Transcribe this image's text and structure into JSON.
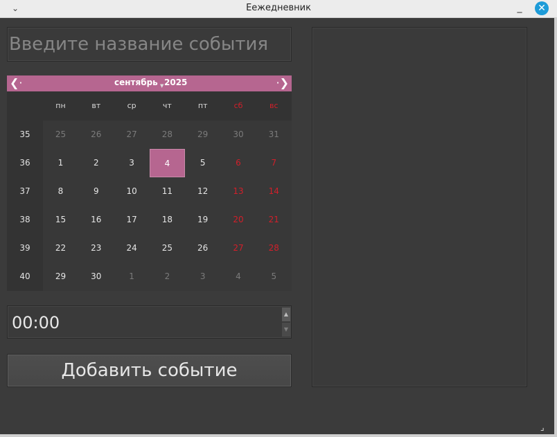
{
  "window": {
    "title": "Еежедневник",
    "menu_icon": "chevron-down-icon",
    "minimize_label": "_",
    "close_label": "✕"
  },
  "event_title_input": {
    "placeholder": "Введите название события",
    "value": ""
  },
  "calendar": {
    "month": "сентябрь",
    "year": "2025",
    "prev_icon": "left-arrow-icon",
    "next_icon": "right-arrow-icon",
    "day_names": [
      "пн",
      "вт",
      "ср",
      "чт",
      "пт",
      "сб",
      "вс"
    ],
    "weeks": [
      {
        "num": "35",
        "days": [
          "25",
          "26",
          "27",
          "28",
          "29",
          "30",
          "31"
        ]
      },
      {
        "num": "36",
        "days": [
          "1",
          "2",
          "3",
          "4",
          "5",
          "6",
          "7"
        ]
      },
      {
        "num": "37",
        "days": [
          "8",
          "9",
          "10",
          "11",
          "12",
          "13",
          "14"
        ]
      },
      {
        "num": "38",
        "days": [
          "15",
          "16",
          "17",
          "18",
          "19",
          "20",
          "21"
        ]
      },
      {
        "num": "39",
        "days": [
          "22",
          "23",
          "24",
          "25",
          "26",
          "27",
          "28"
        ]
      },
      {
        "num": "40",
        "days": [
          "29",
          "30",
          "1",
          "2",
          "3",
          "4",
          "5"
        ]
      }
    ],
    "selected_day": "4",
    "colors": {
      "accent": "#b66690",
      "weekend": "#d21f2a"
    }
  },
  "time_input": {
    "value": "00:00"
  },
  "add_button": {
    "label": "Добавить событие"
  },
  "events_list": {
    "items": []
  }
}
